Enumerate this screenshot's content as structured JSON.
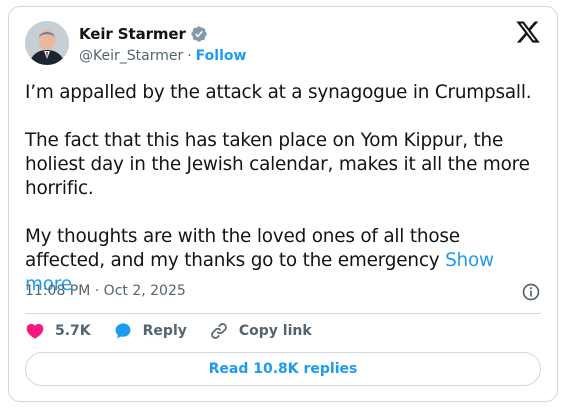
{
  "author": {
    "name": "Keir Starmer",
    "handle": "@Keir_Starmer",
    "separator": "·",
    "follow_label": "Follow",
    "verified_icon": "verified-badge-icon"
  },
  "tweet": {
    "paragraphs": [
      "I’m appalled by the attack at a synagogue in Crumpsall.",
      "The fact that this has taken place on Yom Kippur, the holiest day in the Jewish calendar, makes it all the more horrific.",
      "My thoughts are with the loved ones of all those affected, and my thanks go to the emergency"
    ],
    "show_more_label": "Show more",
    "timestamp": "11:08 PM · Oct 2, 2025"
  },
  "actions": {
    "likes": "5.7K",
    "reply_label": "Reply",
    "copy_link_label": "Copy link"
  },
  "read_replies_label": "Read 10.8K replies",
  "colors": {
    "accent": "#1d9bf0",
    "like": "#f91880",
    "text": "#0f1419",
    "muted": "#536471",
    "border": "#cfd9de"
  }
}
